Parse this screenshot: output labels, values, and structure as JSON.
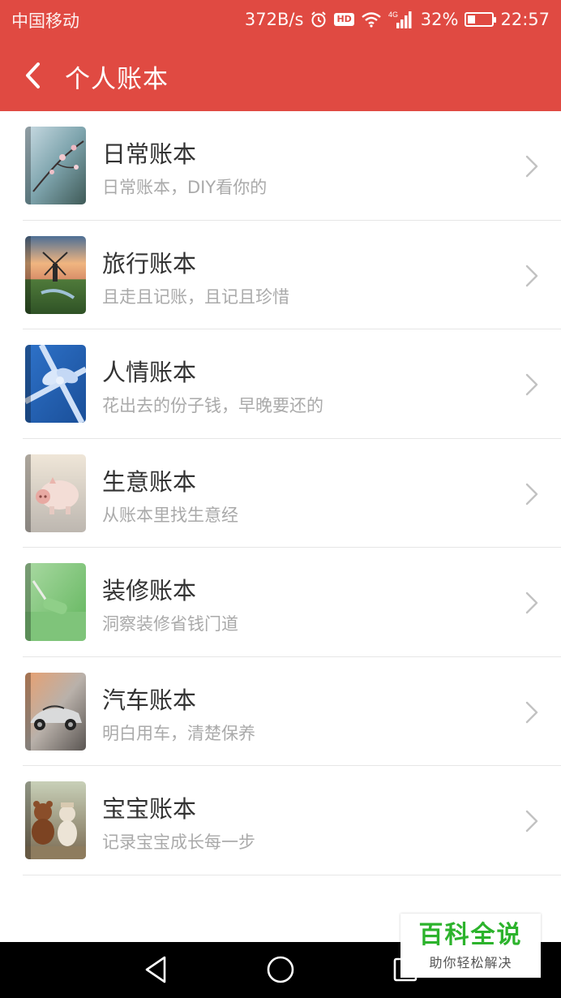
{
  "status_bar": {
    "carrier": "中国移动",
    "speed": "372B/s",
    "hd": "HD",
    "net": "4G",
    "battery": "32%",
    "battery_level": 0.32,
    "time": "22:57"
  },
  "header": {
    "title": "个人账本",
    "bg_color": "#e04a42"
  },
  "books": [
    {
      "name": "日常账本",
      "desc": "日常账本，DIY看你的",
      "thumb": "blossom-photo"
    },
    {
      "name": "旅行账本",
      "desc": "且走且记账，且记且珍惜",
      "thumb": "windmill-photo"
    },
    {
      "name": "人情账本",
      "desc": "花出去的份子钱，早晚要还的",
      "thumb": "gift-ribbon-photo"
    },
    {
      "name": "生意账本",
      "desc": "从账本里找生意经",
      "thumb": "piggy-bank-photo"
    },
    {
      "name": "装修账本",
      "desc": "洞察装修省钱门道",
      "thumb": "paint-roller-photo"
    },
    {
      "name": "汽车账本",
      "desc": "明白用车，清楚保养",
      "thumb": "sports-car-photo"
    },
    {
      "name": "宝宝账本",
      "desc": "记录宝宝成长每一步",
      "thumb": "teddy-bear-photo"
    }
  ],
  "watermark": {
    "title": "百科全说",
    "subtitle": "助你轻松解决"
  }
}
